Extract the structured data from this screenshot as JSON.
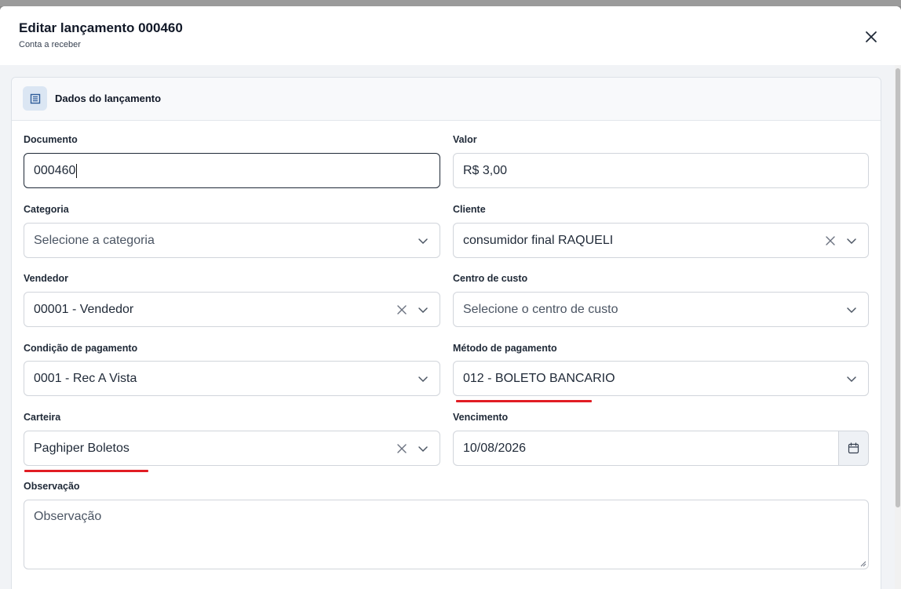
{
  "modal": {
    "title": "Editar lançamento 000460",
    "subtitle": "Conta a receber"
  },
  "card": {
    "title": "Dados do lançamento"
  },
  "fields": {
    "documento": {
      "label": "Documento",
      "value": "000460"
    },
    "valor": {
      "label": "Valor",
      "value": "R$ 3,00"
    },
    "categoria": {
      "label": "Categoria",
      "placeholder": "Selecione a categoria"
    },
    "cliente": {
      "label": "Cliente",
      "value": "consumidor final RAQUELI"
    },
    "vendedor": {
      "label": "Vendedor",
      "value": "00001 - Vendedor"
    },
    "centro_custo": {
      "label": "Centro de custo",
      "placeholder": "Selecione o centro de custo"
    },
    "condicao_pagamento": {
      "label": "Condição de pagamento",
      "value": "0001 - Rec A Vista"
    },
    "metodo_pagamento": {
      "label": "Método de pagamento",
      "value": "012 - BOLETO BANCARIO"
    },
    "carteira": {
      "label": "Carteira",
      "value": "Paghiper Boletos"
    },
    "vencimento": {
      "label": "Vencimento",
      "value": "10/08/2026"
    },
    "observacao": {
      "label": "Observação",
      "placeholder": "Observação"
    }
  },
  "colors": {
    "highlight_underline": "#e11d24",
    "icon_bg": "#dbe6f3",
    "body_bg": "#f1f3f6"
  },
  "icons": {
    "close": "close-icon",
    "card": "document-icon",
    "chevron": "chevron-down-icon",
    "clear": "clear-icon",
    "calendar": "calendar-icon"
  }
}
